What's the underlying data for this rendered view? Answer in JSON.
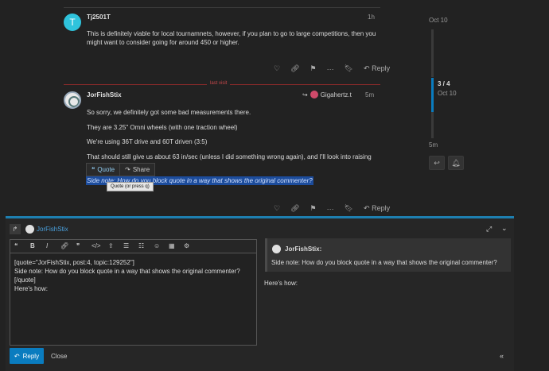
{
  "posts": [
    {
      "username": "Tj2501T",
      "avatar_letter": "T",
      "time": "1h",
      "text": "This is definitely viable for local tournamnets, however, if you plan to go to large competitions, then you might want to consider going for around 450 or higher.",
      "reply_label": "Reply"
    },
    {
      "username": "JorFishStix",
      "time": "5m",
      "reply_to": "Gigahertz.t",
      "paragraphs": [
        "So sorry, we definitely got some bad measurements there.",
        "They are 3.25\" Omni wheels (with one traction wheel)",
        "We're using 36T drive and 60T driven (3:5)",
        "That should still give us about 63 in/sec (unless I did something wrong again), and I'll look into raising"
      ],
      "selected_text": "Side note: How do you block quote in a way that shows the original commenter?",
      "reply_label": "Reply"
    }
  ],
  "last_visit_label": "last visit",
  "quote_popup": {
    "quote_label": "Quote",
    "share_label": "Share",
    "tooltip": "Quote (or press q)"
  },
  "timeline": {
    "top_date": "Oct 10",
    "position": "3 / 4",
    "position_date": "Oct 10",
    "bottom_label": "5m",
    "progress_fraction": 0.75
  },
  "composer": {
    "reply_to_user": "JorFishStix",
    "editor_text": "[quote=\"JorFishStix, post:4, topic:129252\"]\nSide note: How do you block quote in a way that shows the original commenter?\n[/quote]\nHere's how:",
    "preview_quote_user": "JorFishStix:",
    "preview_quote_text": "Side note: How do you block quote in a way that shows the original commenter?",
    "preview_body": "Here's how:",
    "reply_button": "Reply",
    "close_button": "Close"
  },
  "colors": {
    "accent": "#0a7cbf",
    "background": "#222222",
    "last_visit": "#c9484b",
    "selection": "#1c4c9c"
  }
}
